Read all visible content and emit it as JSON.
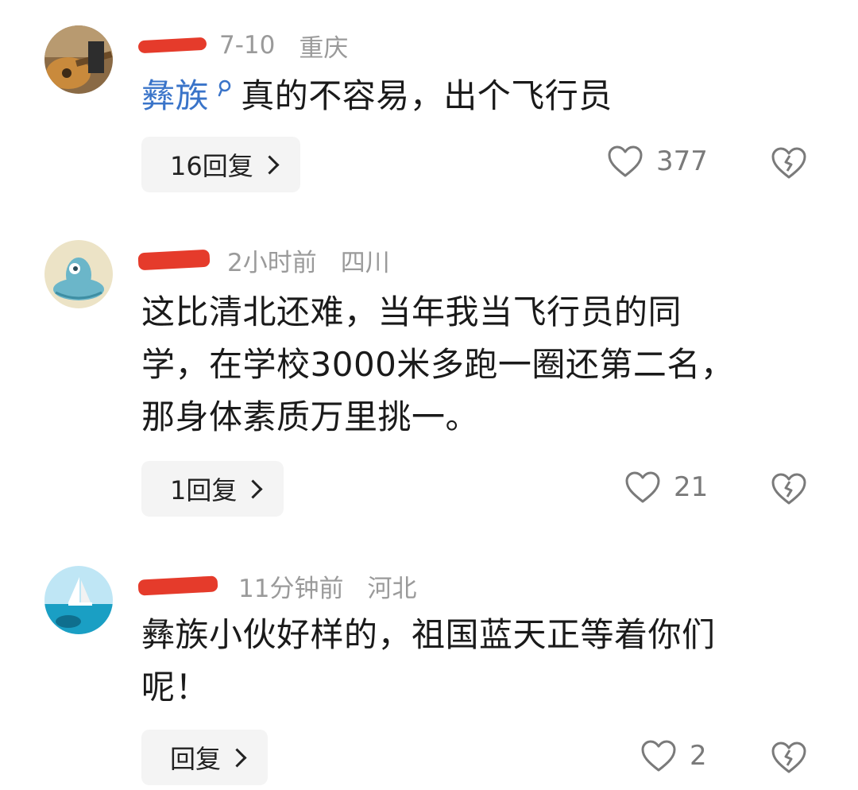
{
  "comments": [
    {
      "time": "7-10",
      "location": "重庆",
      "tag": "彝族",
      "tag_icon": "search-icon",
      "text": "真的不容易，出个飞行员",
      "reply_label": "16回复",
      "likes": "377"
    },
    {
      "time": "2小时前",
      "location": "四川",
      "lines": [
        "这比清北还难，当年我当飞行员的同",
        "学，在学校3000米多跑一圈还第二名，",
        "那身体素质万里挑一。"
      ],
      "reply_label": "1回复",
      "likes": "21"
    },
    {
      "time": "11分钟前",
      "location": "河北",
      "lines": [
        "彝族小伙好样的，祖国蓝天正等着你们",
        "呢！"
      ],
      "reply_label": "回复",
      "likes": "2"
    }
  ],
  "colors": {
    "redaction": "#e53b2b",
    "tag": "#3a74c9",
    "meta": "#9a9a9a"
  }
}
